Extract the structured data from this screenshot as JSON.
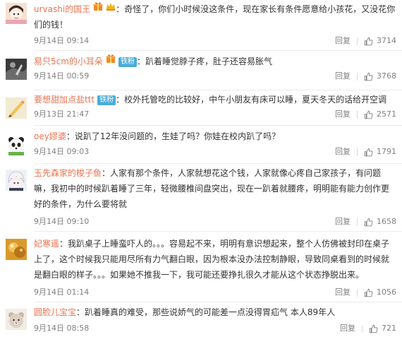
{
  "comments": [
    {
      "user": "urvashi的国王",
      "badges": [
        "gift",
        "hat"
      ],
      "text": "：奇怪了，你们小时候没这条件，现在家长有条件愿意给小孩花，又没花你们的钱！",
      "time": "9月14日 09:14",
      "reply": "回复",
      "likes": "3714",
      "avatar_icon": "cartoon-girl-avatar"
    },
    {
      "user": "易只5cm的小耳朵",
      "badges": [
        "gift",
        "fan"
      ],
      "fan_label": "铁粉",
      "text": "：趴着睡觉脖子疼，肚子还容易胀气",
      "time": "9月14日 00:59",
      "reply": "回复",
      "likes": "3768",
      "avatar_icon": "dark-photo-avatar"
    },
    {
      "user": "要想甜加点盐ttt",
      "badges": [
        "fan"
      ],
      "fan_label": "铁粉",
      "text": "：校外托管吃的比较好，中午小朋友有床可以睡，夏天冬天的话给开空调",
      "time": "9月13日 21:47",
      "reply": "回复",
      "likes": "2571",
      "avatar_icon": "pencil-sketch-avatar"
    },
    {
      "user": "oey嫪婆",
      "badges": [],
      "text": "：说趴了12年没问题的，生娃了吗？你娃在校内趴了吗？",
      "time": "9月14日 09:03",
      "reply": "回复",
      "likes": "1791",
      "avatar_icon": "panda-avatar"
    },
    {
      "user": "玉先森家的梭子鱼",
      "badges": [],
      "text": "：人家有那个条件，人家就想花这个钱，人家就像心疼自己家孩子，有问题嘛，我初中的时候趴着睡了三年，轻微腰椎间盘突出，现在一趴着就腰疼，明明能有能力创作更好的条件，为什么要将就",
      "time": "9月14日 09:10",
      "reply": "回复",
      "likes": "1658",
      "avatar_icon": "anime-character-avatar"
    },
    {
      "user": "妃寒遥",
      "badges": [],
      "text": "：我趴桌子上睡蛮吓人的。。。容易起不来，明明有意识想起来，整个人仿佛被封印在桌子上了，这个时候我只能用尽所有力气翻白眼，因为根本没办法控制静眼，导致同桌看到的时候就是翻白眼的样子。。。如果她不推我一下，我可能还要挣扎很久才能从这个状态挣脱出来。",
      "time": "9月14日 01:14",
      "reply": "回复",
      "likes": "1056",
      "avatar_icon": "amber-photo-avatar"
    },
    {
      "user": "圆脸儿宝宝",
      "badges": [],
      "text": "：趴着睡真的难受，那些说娇气的可能差一点没得胃疝气 本人89年人",
      "time": "9月14日 08:58",
      "reply": "回复",
      "likes": "721",
      "avatar_icon": "bear-avatar"
    }
  ],
  "colors": {
    "username": "#eb7350",
    "text": "#333333",
    "meta": "#808080",
    "fan_badge": "#4bacd9"
  }
}
